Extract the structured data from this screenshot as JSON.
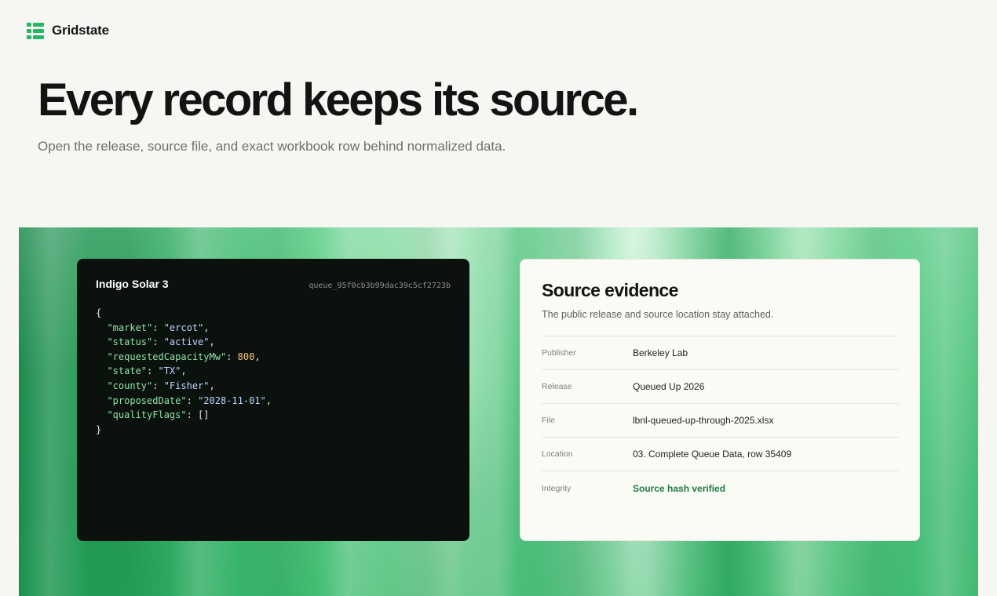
{
  "brand": {
    "name": "Gridstate",
    "icon": "gridstate-logo-icon"
  },
  "hero": {
    "title": "Every record keeps its source.",
    "subtitle": "Open the release, source file, and exact workbook row behind normalized data."
  },
  "record": {
    "title": "Indigo Solar 3",
    "id": "queue_95f0cb3b99dac39c5cf2723b",
    "json_lines": [
      [
        {
          "t": "p",
          "v": "{"
        }
      ],
      [
        {
          "t": "p",
          "v": "  "
        },
        {
          "t": "k",
          "v": "\"market\""
        },
        {
          "t": "p",
          "v": ": "
        },
        {
          "t": "s",
          "v": "\"ercot\""
        },
        {
          "t": "p",
          "v": ","
        }
      ],
      [
        {
          "t": "p",
          "v": "  "
        },
        {
          "t": "k",
          "v": "\"status\""
        },
        {
          "t": "p",
          "v": ": "
        },
        {
          "t": "s",
          "v": "\"active\""
        },
        {
          "t": "p",
          "v": ","
        }
      ],
      [
        {
          "t": "p",
          "v": "  "
        },
        {
          "t": "k",
          "v": "\"requestedCapacityMw\""
        },
        {
          "t": "p",
          "v": ": "
        },
        {
          "t": "n",
          "v": "800"
        },
        {
          "t": "p",
          "v": ","
        }
      ],
      [
        {
          "t": "p",
          "v": "  "
        },
        {
          "t": "k",
          "v": "\"state\""
        },
        {
          "t": "p",
          "v": ": "
        },
        {
          "t": "s",
          "v": "\"TX\""
        },
        {
          "t": "p",
          "v": ","
        }
      ],
      [
        {
          "t": "p",
          "v": "  "
        },
        {
          "t": "k",
          "v": "\"county\""
        },
        {
          "t": "p",
          "v": ": "
        },
        {
          "t": "s",
          "v": "\"Fisher\""
        },
        {
          "t": "p",
          "v": ","
        }
      ],
      [
        {
          "t": "p",
          "v": "  "
        },
        {
          "t": "k",
          "v": "\"proposedDate\""
        },
        {
          "t": "p",
          "v": ": "
        },
        {
          "t": "s",
          "v": "\"2028-11-01\""
        },
        {
          "t": "p",
          "v": ","
        }
      ],
      [
        {
          "t": "p",
          "v": "  "
        },
        {
          "t": "k",
          "v": "\"qualityFlags\""
        },
        {
          "t": "p",
          "v": ": []"
        }
      ],
      [
        {
          "t": "p",
          "v": "}"
        }
      ]
    ]
  },
  "evidence": {
    "title": "Source evidence",
    "subtitle": "The public release and source location stay attached.",
    "rows": [
      {
        "label": "Publisher",
        "value": "Berkeley Lab"
      },
      {
        "label": "Release",
        "value": "Queued Up 2026"
      },
      {
        "label": "File",
        "value": "lbnl-queued-up-through-2025.xlsx"
      },
      {
        "label": "Location",
        "value": "03. Complete Queue Data, row 35409"
      },
      {
        "label": "Integrity",
        "value": "Source hash verified",
        "status": "verified"
      }
    ]
  },
  "colors": {
    "accent": "#22b866",
    "verified": "#1f7a45",
    "code_bg": "#0b120e"
  }
}
